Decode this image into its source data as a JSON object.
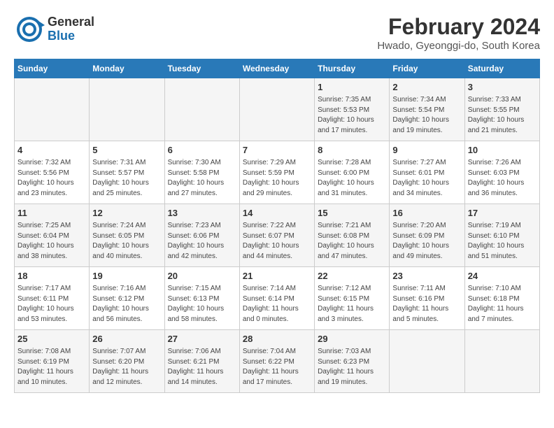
{
  "header": {
    "logo_line1": "General",
    "logo_line2": "Blue",
    "main_title": "February 2024",
    "subtitle": "Hwado, Gyeonggi-do, South Korea"
  },
  "days_of_week": [
    "Sunday",
    "Monday",
    "Tuesday",
    "Wednesday",
    "Thursday",
    "Friday",
    "Saturday"
  ],
  "weeks": [
    [
      {
        "day": "",
        "info": ""
      },
      {
        "day": "",
        "info": ""
      },
      {
        "day": "",
        "info": ""
      },
      {
        "day": "",
        "info": ""
      },
      {
        "day": "1",
        "info": "Sunrise: 7:35 AM\nSunset: 5:53 PM\nDaylight: 10 hours\nand 17 minutes."
      },
      {
        "day": "2",
        "info": "Sunrise: 7:34 AM\nSunset: 5:54 PM\nDaylight: 10 hours\nand 19 minutes."
      },
      {
        "day": "3",
        "info": "Sunrise: 7:33 AM\nSunset: 5:55 PM\nDaylight: 10 hours\nand 21 minutes."
      }
    ],
    [
      {
        "day": "4",
        "info": "Sunrise: 7:32 AM\nSunset: 5:56 PM\nDaylight: 10 hours\nand 23 minutes."
      },
      {
        "day": "5",
        "info": "Sunrise: 7:31 AM\nSunset: 5:57 PM\nDaylight: 10 hours\nand 25 minutes."
      },
      {
        "day": "6",
        "info": "Sunrise: 7:30 AM\nSunset: 5:58 PM\nDaylight: 10 hours\nand 27 minutes."
      },
      {
        "day": "7",
        "info": "Sunrise: 7:29 AM\nSunset: 5:59 PM\nDaylight: 10 hours\nand 29 minutes."
      },
      {
        "day": "8",
        "info": "Sunrise: 7:28 AM\nSunset: 6:00 PM\nDaylight: 10 hours\nand 31 minutes."
      },
      {
        "day": "9",
        "info": "Sunrise: 7:27 AM\nSunset: 6:01 PM\nDaylight: 10 hours\nand 34 minutes."
      },
      {
        "day": "10",
        "info": "Sunrise: 7:26 AM\nSunset: 6:03 PM\nDaylight: 10 hours\nand 36 minutes."
      }
    ],
    [
      {
        "day": "11",
        "info": "Sunrise: 7:25 AM\nSunset: 6:04 PM\nDaylight: 10 hours\nand 38 minutes."
      },
      {
        "day": "12",
        "info": "Sunrise: 7:24 AM\nSunset: 6:05 PM\nDaylight: 10 hours\nand 40 minutes."
      },
      {
        "day": "13",
        "info": "Sunrise: 7:23 AM\nSunset: 6:06 PM\nDaylight: 10 hours\nand 42 minutes."
      },
      {
        "day": "14",
        "info": "Sunrise: 7:22 AM\nSunset: 6:07 PM\nDaylight: 10 hours\nand 44 minutes."
      },
      {
        "day": "15",
        "info": "Sunrise: 7:21 AM\nSunset: 6:08 PM\nDaylight: 10 hours\nand 47 minutes."
      },
      {
        "day": "16",
        "info": "Sunrise: 7:20 AM\nSunset: 6:09 PM\nDaylight: 10 hours\nand 49 minutes."
      },
      {
        "day": "17",
        "info": "Sunrise: 7:19 AM\nSunset: 6:10 PM\nDaylight: 10 hours\nand 51 minutes."
      }
    ],
    [
      {
        "day": "18",
        "info": "Sunrise: 7:17 AM\nSunset: 6:11 PM\nDaylight: 10 hours\nand 53 minutes."
      },
      {
        "day": "19",
        "info": "Sunrise: 7:16 AM\nSunset: 6:12 PM\nDaylight: 10 hours\nand 56 minutes."
      },
      {
        "day": "20",
        "info": "Sunrise: 7:15 AM\nSunset: 6:13 PM\nDaylight: 10 hours\nand 58 minutes."
      },
      {
        "day": "21",
        "info": "Sunrise: 7:14 AM\nSunset: 6:14 PM\nDaylight: 11 hours\nand 0 minutes."
      },
      {
        "day": "22",
        "info": "Sunrise: 7:12 AM\nSunset: 6:15 PM\nDaylight: 11 hours\nand 3 minutes."
      },
      {
        "day": "23",
        "info": "Sunrise: 7:11 AM\nSunset: 6:16 PM\nDaylight: 11 hours\nand 5 minutes."
      },
      {
        "day": "24",
        "info": "Sunrise: 7:10 AM\nSunset: 6:18 PM\nDaylight: 11 hours\nand 7 minutes."
      }
    ],
    [
      {
        "day": "25",
        "info": "Sunrise: 7:08 AM\nSunset: 6:19 PM\nDaylight: 11 hours\nand 10 minutes."
      },
      {
        "day": "26",
        "info": "Sunrise: 7:07 AM\nSunset: 6:20 PM\nDaylight: 11 hours\nand 12 minutes."
      },
      {
        "day": "27",
        "info": "Sunrise: 7:06 AM\nSunset: 6:21 PM\nDaylight: 11 hours\nand 14 minutes."
      },
      {
        "day": "28",
        "info": "Sunrise: 7:04 AM\nSunset: 6:22 PM\nDaylight: 11 hours\nand 17 minutes."
      },
      {
        "day": "29",
        "info": "Sunrise: 7:03 AM\nSunset: 6:23 PM\nDaylight: 11 hours\nand 19 minutes."
      },
      {
        "day": "",
        "info": ""
      },
      {
        "day": "",
        "info": ""
      }
    ]
  ]
}
